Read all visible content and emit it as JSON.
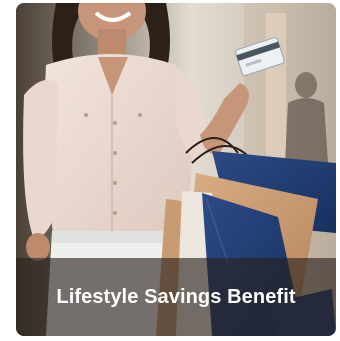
{
  "card": {
    "title": "Lifestyle Savings Benefit",
    "image_subject": "woman-holding-credit-card-and-shopping-bags"
  }
}
